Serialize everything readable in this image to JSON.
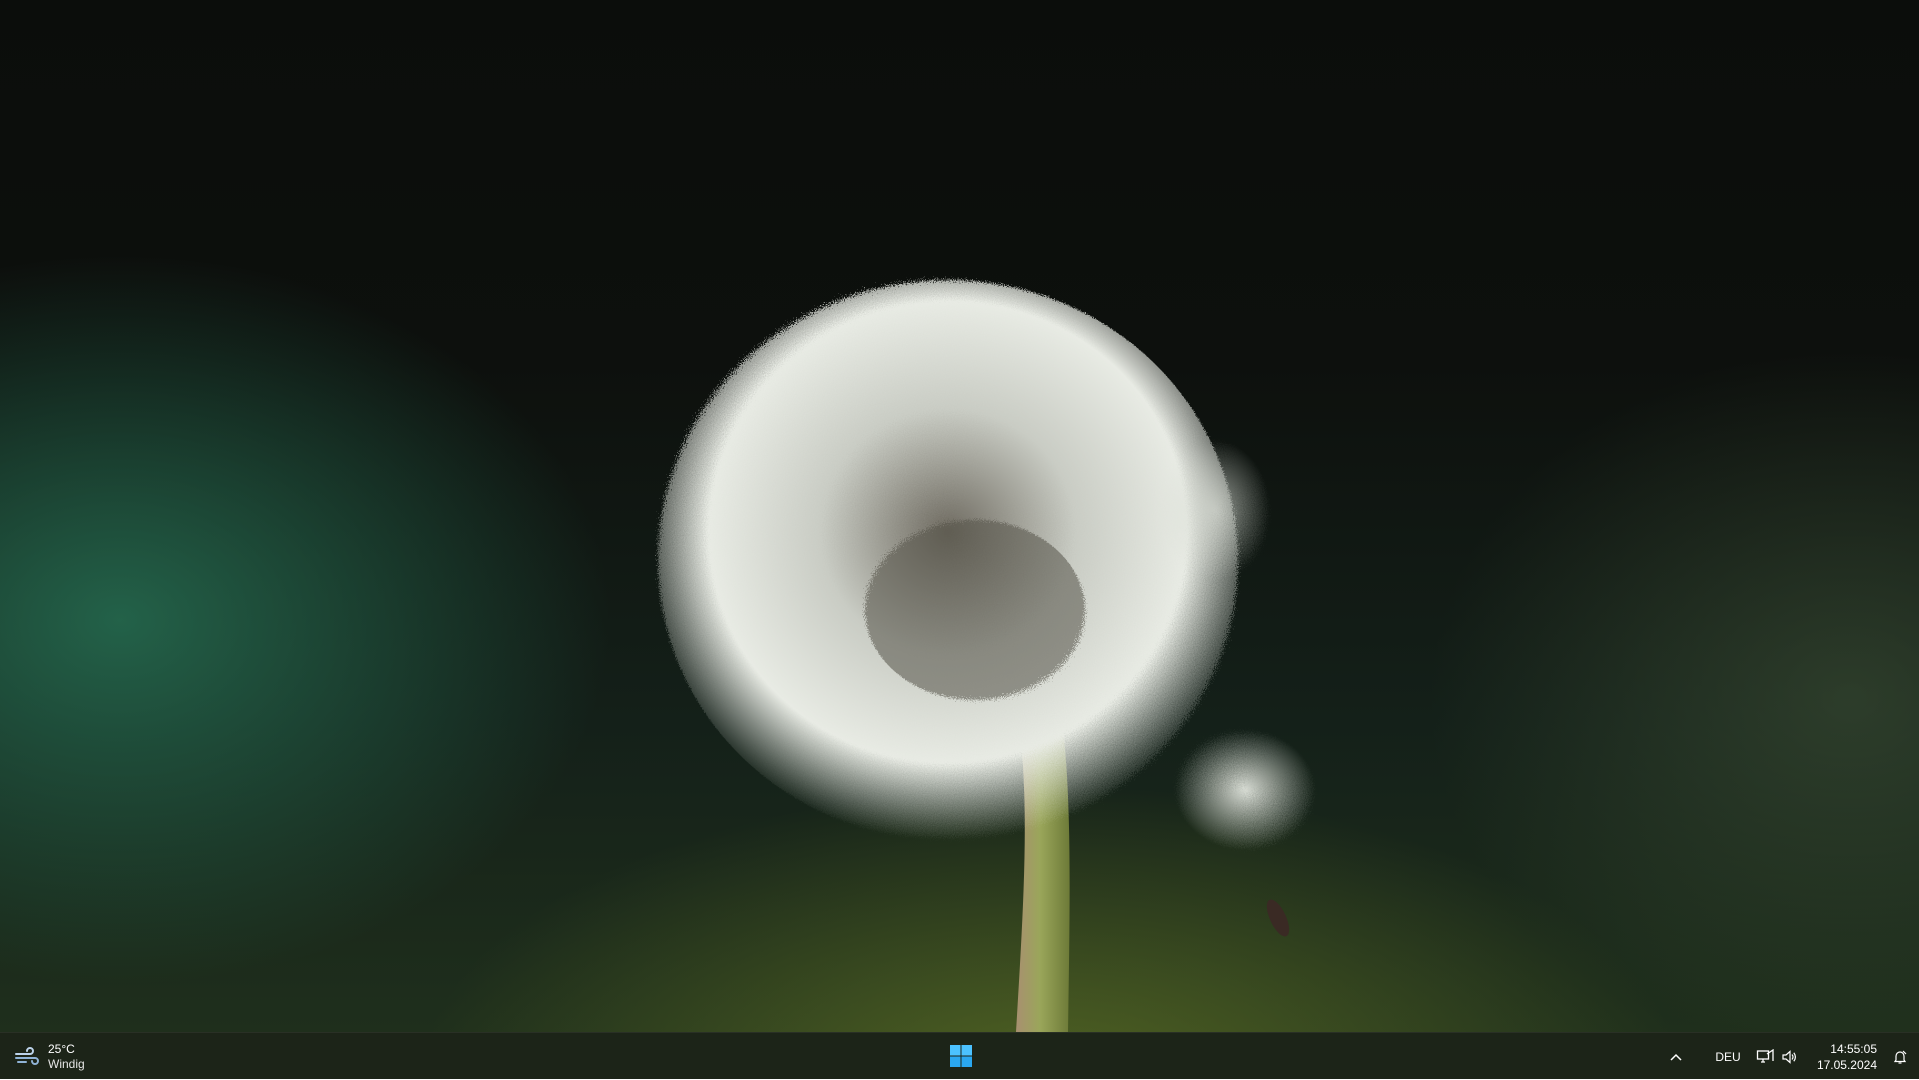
{
  "wallpaper": {
    "subject": "dandelion seed head painting",
    "accent_colors": [
      "#0b0d0b",
      "#266e52",
      "#788c28",
      "#e9ece6"
    ]
  },
  "taskbar": {
    "background": "#1c2418",
    "weather": {
      "icon": "wind-icon",
      "temperature": "25°C",
      "condition": "Windig"
    },
    "start_icon": "windows-logo-icon",
    "tray": {
      "overflow_icon": "chevron-up-icon",
      "language": "DEU",
      "network_icon": "network-icon",
      "volume_icon": "speaker-icon",
      "time": "14:55:05",
      "date": "17.05.2024",
      "notification_icon": "notification-bell-icon"
    }
  }
}
